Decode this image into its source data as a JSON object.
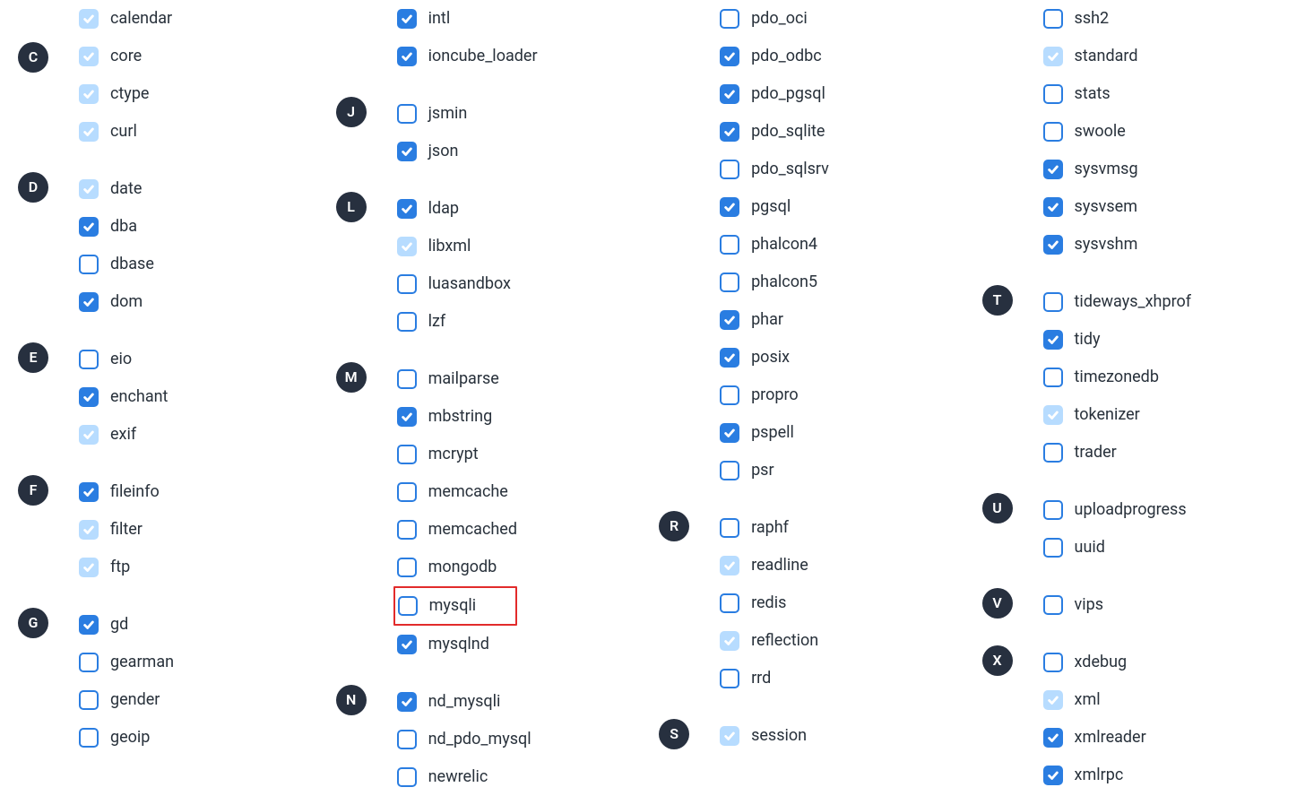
{
  "columns": [
    [
      {
        "letter": "",
        "items": [
          {
            "label": "calendar",
            "state": "checked-disabled"
          },
          {
            "label": "core",
            "state": "checked-disabled"
          },
          {
            "label": "ctype",
            "state": "checked-disabled"
          },
          {
            "label": "curl",
            "state": "checked-disabled"
          }
        ],
        "letterPlacement": "C",
        "letterItemIndex": 1
      },
      {
        "letter": "D",
        "items": [
          {
            "label": "date",
            "state": "checked-disabled"
          },
          {
            "label": "dba",
            "state": "checked"
          },
          {
            "label": "dbase",
            "state": "unchecked"
          },
          {
            "label": "dom",
            "state": "checked"
          }
        ]
      },
      {
        "letter": "E",
        "items": [
          {
            "label": "eio",
            "state": "unchecked"
          },
          {
            "label": "enchant",
            "state": "checked"
          },
          {
            "label": "exif",
            "state": "checked-disabled"
          }
        ]
      },
      {
        "letter": "F",
        "items": [
          {
            "label": "fileinfo",
            "state": "checked"
          },
          {
            "label": "filter",
            "state": "checked-disabled"
          },
          {
            "label": "ftp",
            "state": "checked-disabled"
          }
        ]
      },
      {
        "letter": "G",
        "items": [
          {
            "label": "gd",
            "state": "checked"
          },
          {
            "label": "gearman",
            "state": "unchecked"
          },
          {
            "label": "gender",
            "state": "unchecked"
          },
          {
            "label": "geoip",
            "state": "unchecked"
          }
        ]
      }
    ],
    [
      {
        "letter": "",
        "items": [
          {
            "label": "intl",
            "state": "checked"
          },
          {
            "label": "ioncube_loader",
            "state": "checked"
          }
        ]
      },
      {
        "letter": "J",
        "items": [
          {
            "label": "jsmin",
            "state": "unchecked"
          },
          {
            "label": "json",
            "state": "checked"
          }
        ]
      },
      {
        "letter": "L",
        "items": [
          {
            "label": "ldap",
            "state": "checked"
          },
          {
            "label": "libxml",
            "state": "checked-disabled"
          },
          {
            "label": "luasandbox",
            "state": "unchecked"
          },
          {
            "label": "lzf",
            "state": "unchecked"
          }
        ]
      },
      {
        "letter": "M",
        "items": [
          {
            "label": "mailparse",
            "state": "unchecked"
          },
          {
            "label": "mbstring",
            "state": "checked"
          },
          {
            "label": "mcrypt",
            "state": "unchecked"
          },
          {
            "label": "memcache",
            "state": "unchecked"
          },
          {
            "label": "memcached",
            "state": "unchecked"
          },
          {
            "label": "mongodb",
            "state": "unchecked"
          },
          {
            "label": "mysqli",
            "state": "unchecked",
            "highlight": true
          },
          {
            "label": "mysqlnd",
            "state": "checked"
          }
        ]
      },
      {
        "letter": "N",
        "items": [
          {
            "label": "nd_mysqli",
            "state": "checked"
          },
          {
            "label": "nd_pdo_mysql",
            "state": "unchecked"
          },
          {
            "label": "newrelic",
            "state": "unchecked"
          }
        ]
      }
    ],
    [
      {
        "letter": "",
        "items": [
          {
            "label": "pdo_oci",
            "state": "unchecked"
          },
          {
            "label": "pdo_odbc",
            "state": "checked"
          },
          {
            "label": "pdo_pgsql",
            "state": "checked"
          },
          {
            "label": "pdo_sqlite",
            "state": "checked"
          },
          {
            "label": "pdo_sqlsrv",
            "state": "unchecked"
          },
          {
            "label": "pgsql",
            "state": "checked"
          },
          {
            "label": "phalcon4",
            "state": "unchecked"
          },
          {
            "label": "phalcon5",
            "state": "unchecked"
          },
          {
            "label": "phar",
            "state": "checked"
          },
          {
            "label": "posix",
            "state": "checked"
          },
          {
            "label": "propro",
            "state": "unchecked"
          },
          {
            "label": "pspell",
            "state": "checked"
          },
          {
            "label": "psr",
            "state": "unchecked"
          }
        ]
      },
      {
        "letter": "R",
        "items": [
          {
            "label": "raphf",
            "state": "unchecked"
          },
          {
            "label": "readline",
            "state": "checked-disabled"
          },
          {
            "label": "redis",
            "state": "unchecked"
          },
          {
            "label": "reflection",
            "state": "checked-disabled"
          },
          {
            "label": "rrd",
            "state": "unchecked"
          }
        ]
      },
      {
        "letter": "S",
        "items": [
          {
            "label": "session",
            "state": "checked-disabled"
          }
        ]
      }
    ],
    [
      {
        "letter": "",
        "items": [
          {
            "label": "ssh2",
            "state": "unchecked"
          },
          {
            "label": "standard",
            "state": "checked-disabled"
          },
          {
            "label": "stats",
            "state": "unchecked"
          },
          {
            "label": "swoole",
            "state": "unchecked"
          },
          {
            "label": "sysvmsg",
            "state": "checked"
          },
          {
            "label": "sysvsem",
            "state": "checked"
          },
          {
            "label": "sysvshm",
            "state": "checked"
          }
        ]
      },
      {
        "letter": "T",
        "items": [
          {
            "label": "tideways_xhprof",
            "state": "unchecked"
          },
          {
            "label": "tidy",
            "state": "checked"
          },
          {
            "label": "timezonedb",
            "state": "unchecked"
          },
          {
            "label": "tokenizer",
            "state": "checked-disabled"
          },
          {
            "label": "trader",
            "state": "unchecked"
          }
        ]
      },
      {
        "letter": "U",
        "items": [
          {
            "label": "uploadprogress",
            "state": "unchecked"
          },
          {
            "label": "uuid",
            "state": "unchecked"
          }
        ]
      },
      {
        "letter": "V",
        "items": [
          {
            "label": "vips",
            "state": "unchecked"
          }
        ]
      },
      {
        "letter": "X",
        "items": [
          {
            "label": "xdebug",
            "state": "unchecked"
          },
          {
            "label": "xml",
            "state": "checked-disabled"
          },
          {
            "label": "xmlreader",
            "state": "checked"
          },
          {
            "label": "xmlrpc",
            "state": "checked"
          }
        ]
      }
    ]
  ]
}
